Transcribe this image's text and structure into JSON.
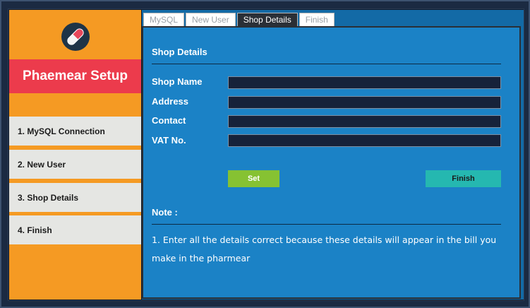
{
  "app": {
    "title": "Phaemear Setup"
  },
  "sidebar": {
    "steps": [
      {
        "label": "1. MySQL Connection"
      },
      {
        "label": "2. New User"
      },
      {
        "label": "3. Shop Details"
      },
      {
        "label": "4. Finish"
      }
    ]
  },
  "tabs": [
    {
      "label": "MySQL",
      "active": false
    },
    {
      "label": "New User",
      "active": false
    },
    {
      "label": "Shop Details",
      "active": true
    },
    {
      "label": "Finish",
      "active": false
    }
  ],
  "shop_details": {
    "heading": "Shop Details",
    "fields": [
      {
        "label": "Shop Name",
        "value": "",
        "placeholder": ""
      },
      {
        "label": "Address",
        "value": "",
        "placeholder": ""
      },
      {
        "label": "Contact",
        "value": "",
        "placeholder": ""
      },
      {
        "label": "VAT No.",
        "value": "",
        "placeholder": ""
      }
    ],
    "set_label": "Set",
    "finish_label": "Finish"
  },
  "note": {
    "heading": "Note :",
    "text": "1. Enter all the details correct because these details will appear in the bill you make in the pharmear"
  },
  "colors": {
    "sidebar_bg": "#f59a23",
    "title_bg": "#ec3b4c",
    "content_bg": "#1b82c6",
    "set_button": "#86c232",
    "finish_button": "#25b8b0"
  },
  "icons": {
    "logo": "pill-capsule-icon"
  }
}
